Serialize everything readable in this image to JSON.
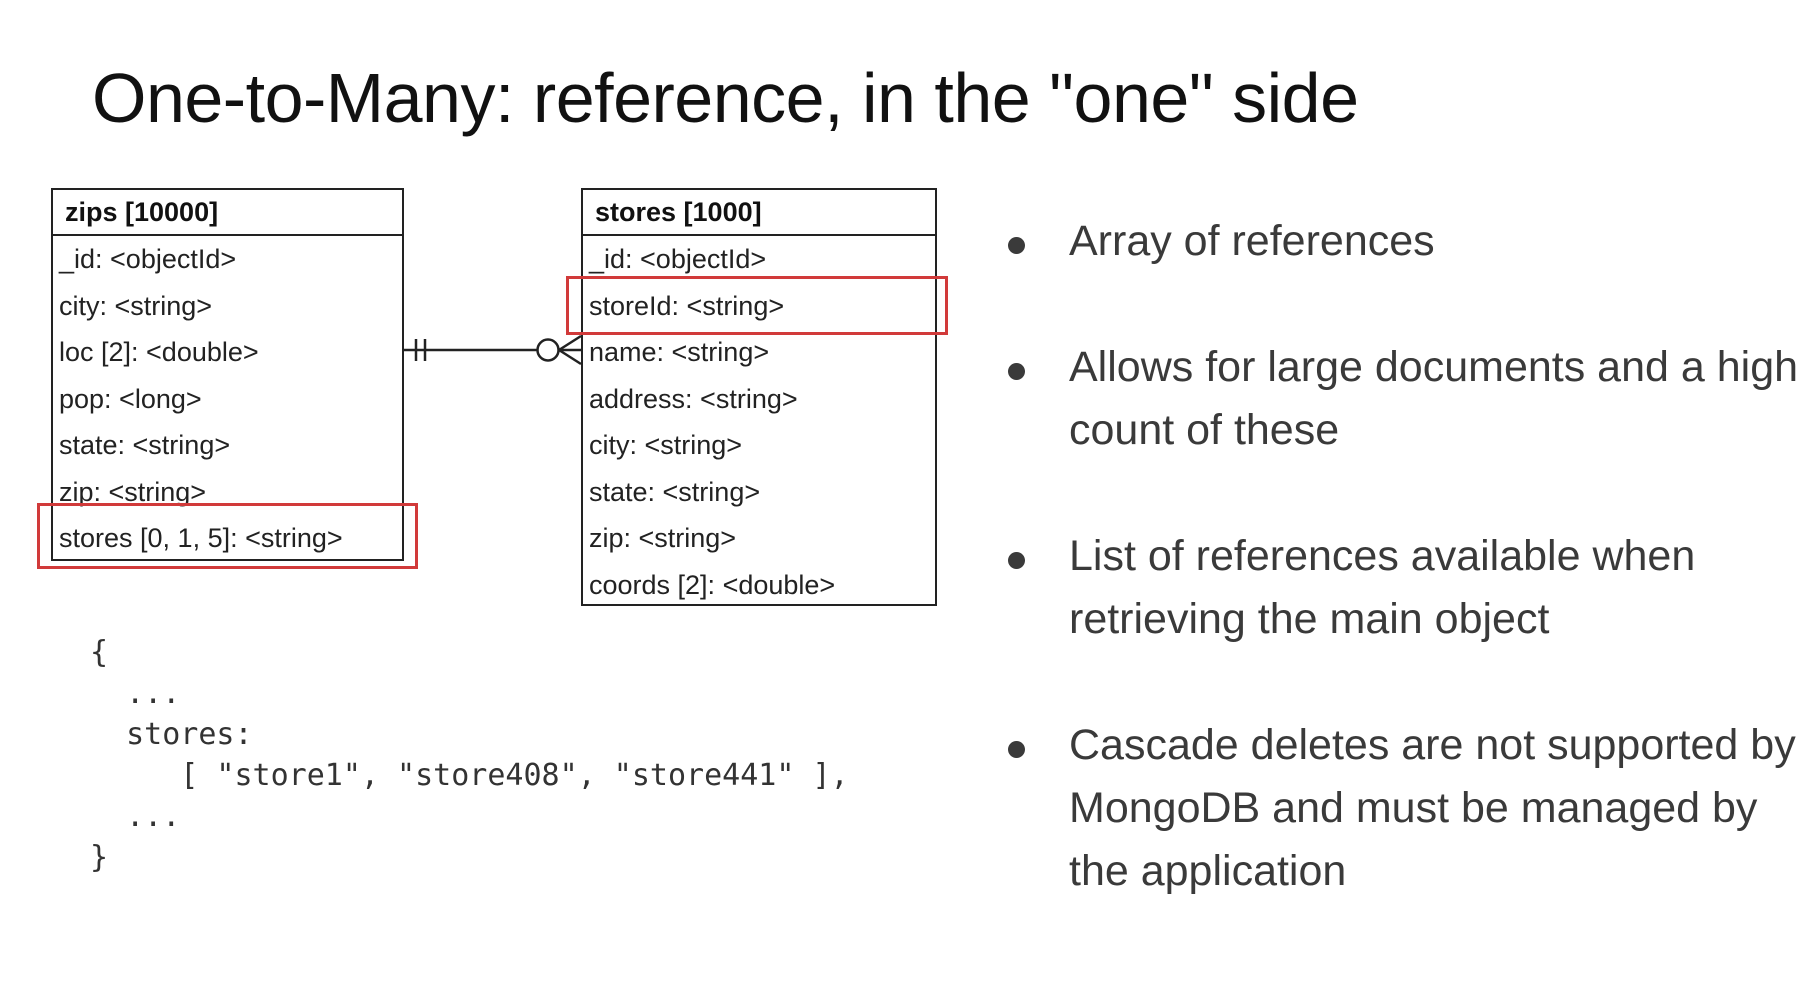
{
  "title": "One-to-Many: reference, in the \"one\" side",
  "zips": {
    "header": "zips [10000]",
    "fields": [
      "_id: <objectId>",
      "city: <string>",
      "loc [2]: <double>",
      "pop: <long>",
      "state: <string>",
      "zip: <string>",
      "stores [0, 1, 5]: <string>"
    ]
  },
  "stores": {
    "header": "stores [1000]",
    "fields": [
      "_id: <objectId>",
      "storeId: <string>",
      "name: <string>",
      "address: <string>",
      "city: <string>",
      "state: <string>",
      "zip: <string>",
      "coords [2]: <double>"
    ]
  },
  "code": {
    "open": "{",
    "ellipsis1": "  ...",
    "key": "  stores:",
    "value": "     [ \"store1\", \"store408\", \"store441\" ],",
    "ellipsis2": "  ...",
    "close": "}"
  },
  "bullets": [
    "Array of references",
    "Allows for large documents and a high count of these",
    "List of references available when retrieving the main object",
    "Cascade deletes are not supported by MongoDB and must be managed by the application"
  ],
  "colors": {
    "highlight": "#d13a3a",
    "text": "#111111",
    "bullet_text": "#3a3a3a"
  }
}
